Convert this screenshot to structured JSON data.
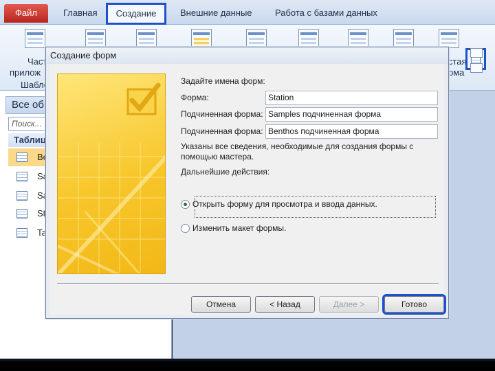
{
  "ribbon": {
    "tabs": {
      "file": "Файл",
      "home": "Главная",
      "create": "Создание",
      "external": "Внешние данные",
      "db_tools": "Работа с базами данных"
    },
    "partial_labels": {
      "parts_line1": "Част",
      "parts_line2": "прилож",
      "templates": "Шабло",
      "right_line1": "стая",
      "right_line2": "рма"
    }
  },
  "nav": {
    "header": "Все об",
    "search_placeholder": "Поиск...",
    "group": "Таблиц",
    "items": [
      "Be",
      "Sa",
      "Sa",
      "St",
      "Ta"
    ]
  },
  "dialog": {
    "title": "Создание форм",
    "prompt": "Задайте имена форм:",
    "form_label": "Форма:",
    "form_value": "Station",
    "subform1_label": "Подчиненная форма:",
    "subform1_value": "Samples подчиненная форма",
    "subform2_label": "Подчиненная форма:",
    "subform2_value": "Benthos подчиненная форма",
    "info_line1": "Указаны все сведения, необходимые для создания формы с",
    "info_line2": "помощью мастера.",
    "next_actions": "Дальнейшие действия:",
    "option_open": "Открыть форму для просмотра и ввода данных.",
    "option_modify": "Изменить макет формы.",
    "selected_option": "option_open",
    "buttons": {
      "cancel": "Отмена",
      "back": "< Назад",
      "next": "Далее >",
      "finish": "Готово"
    }
  },
  "colors": {
    "highlight": "#1c52c9",
    "file_tab": "#c8352c",
    "selected_nav": "#fbd98b",
    "wizard_art": "#f7c62a"
  }
}
